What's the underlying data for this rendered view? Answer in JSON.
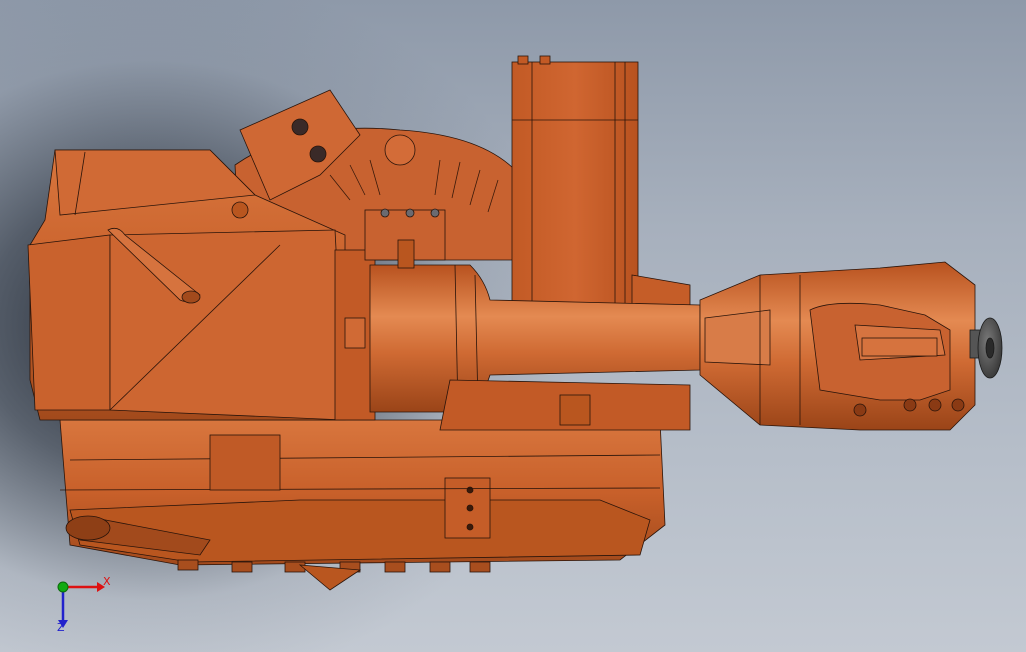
{
  "viewport": {
    "background_top": "#8e99a9",
    "background_bottom": "#c3c9d2",
    "model": {
      "body_color": "#c8602a",
      "shadow_color": "#8a3a14",
      "highlight_color": "#e07a40",
      "edge_color": "#2a140a",
      "tool_flange_color": "#4a4a4a"
    }
  },
  "triad": {
    "x_axis": {
      "label": "X",
      "color": "#dd1111"
    },
    "z_axis": {
      "label": "Z",
      "color": "#2222cc"
    },
    "y_axis": {
      "color": "#11aa11"
    },
    "origin_icon": "triad-origin-icon"
  }
}
